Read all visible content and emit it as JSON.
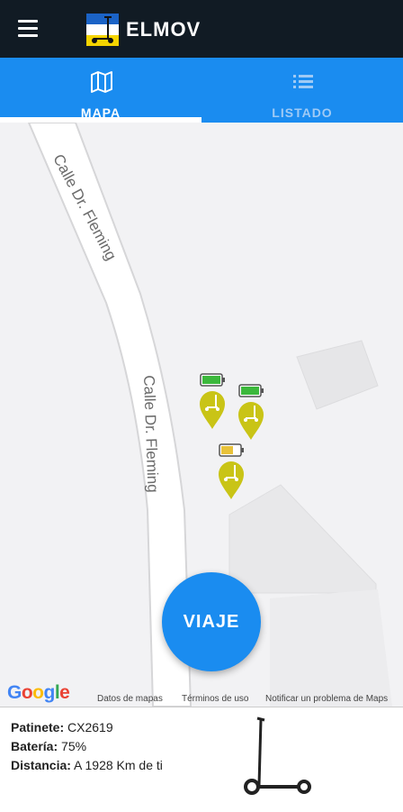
{
  "app": {
    "title": "ELMOV"
  },
  "header": {
    "menu_icon": "hamburger-icon",
    "logo_icon": "scooter-flag-logo"
  },
  "tabs": [
    {
      "label": "MAPA",
      "icon": "map-icon",
      "active": true
    },
    {
      "label": "LISTADO",
      "icon": "list-icon",
      "active": false
    }
  ],
  "map": {
    "street_label": "Calle Dr. Fleming",
    "provider_logo": "Google",
    "attribution": {
      "map_data": "Datos de mapas",
      "terms": "Términos de uso",
      "report": "Notificar un problema de Maps"
    },
    "markers": [
      {
        "icon": "scooter-pin-icon",
        "battery": "full"
      },
      {
        "icon": "scooter-pin-icon",
        "battery": "full"
      },
      {
        "icon": "scooter-pin-icon",
        "battery": "medium"
      }
    ]
  },
  "fab": {
    "label": "VIAJE"
  },
  "info": {
    "patinete_label": "Patinete:",
    "patinete_value": "CX2619",
    "bateria_label": "Batería:",
    "bateria_value": "75%",
    "distancia_label": "Distancia:",
    "distancia_value": "A 1928 Km de ti",
    "image_icon": "electric-scooter-image"
  },
  "colors": {
    "appbar": "#111b24",
    "accent": "#1a8cf0",
    "marker": "#c9c416",
    "battery_full": "#3cb83c",
    "battery_medium": "#e8c23a"
  }
}
